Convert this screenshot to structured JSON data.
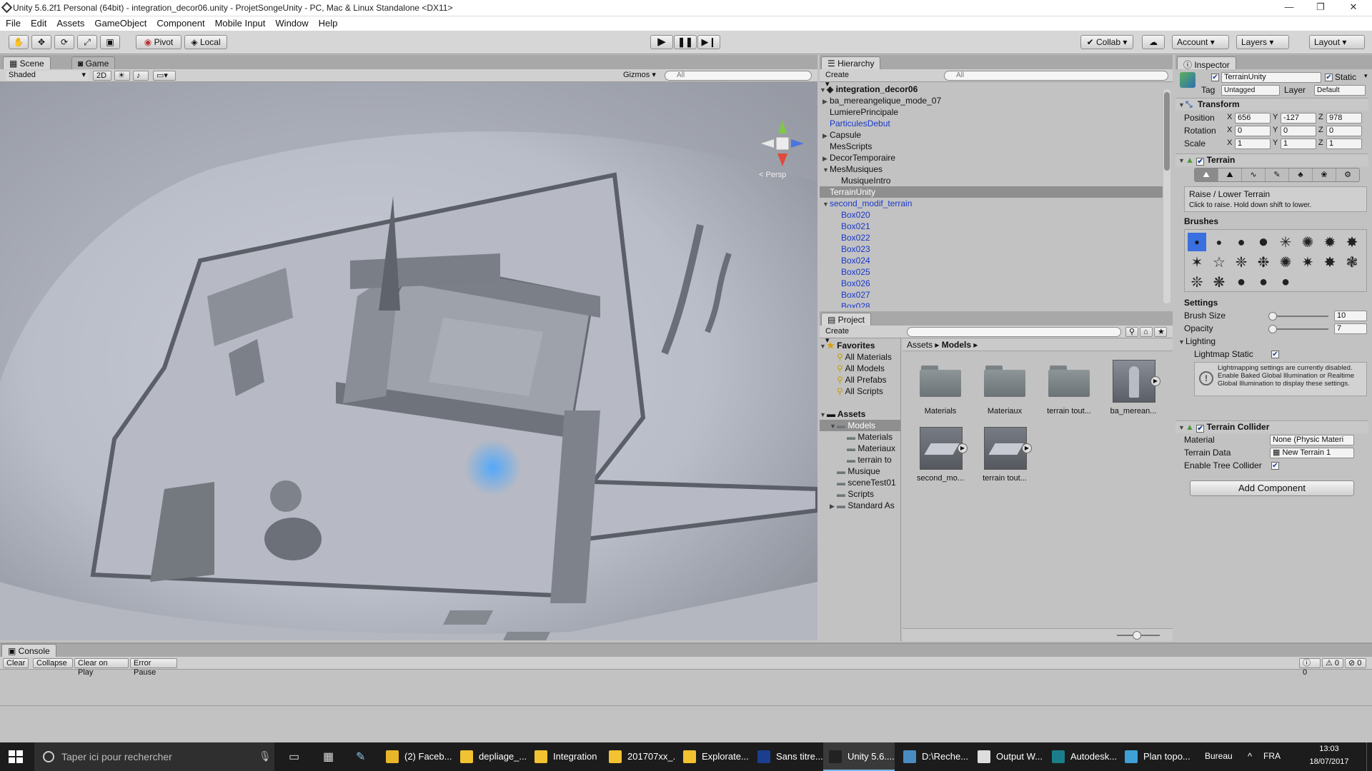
{
  "window": {
    "title": "Unity 5.6.2f1 Personal (64bit) - integration_decor06.unity - ProjetSongeUnity - PC, Mac & Linux Standalone <DX11>",
    "minimize": "—",
    "maximize": "❐",
    "close": "✕"
  },
  "menu": [
    "File",
    "Edit",
    "Assets",
    "GameObject",
    "Component",
    "Mobile Input",
    "Window",
    "Help"
  ],
  "toolbar": {
    "pivot": "Pivot",
    "local": "Local",
    "collab": "Collab",
    "account": "Account",
    "layers": "Layers",
    "layout": "Layout",
    "play_icon": "play-icon",
    "pause_icon": "pause-icon",
    "step_icon": "step-icon"
  },
  "scene": {
    "tab_scene": "Scene",
    "tab_game": "Game",
    "shading": "Shaded",
    "mode_2d": "2D",
    "gizmos": "Gizmos",
    "search_placeholder": "All",
    "persp": "< Persp"
  },
  "hierarchy": {
    "tab": "Hierarchy",
    "create": "Create",
    "search_placeholder": "All",
    "scene_name": "integration_decor06",
    "items": [
      {
        "label": "ba_mereangelique_mode_07",
        "arrow": "▶",
        "indent": 1,
        "blue": false,
        "selected": false
      },
      {
        "label": "LumierePrincipale",
        "arrow": "",
        "indent": 1,
        "blue": false,
        "selected": false
      },
      {
        "label": "ParticulesDebut",
        "arrow": "",
        "indent": 1,
        "blue": true,
        "selected": false
      },
      {
        "label": "Capsule",
        "arrow": "▶",
        "indent": 1,
        "blue": false,
        "selected": false
      },
      {
        "label": "MesScripts",
        "arrow": "",
        "indent": 1,
        "blue": false,
        "selected": false
      },
      {
        "label": "DecorTemporaire",
        "arrow": "▶",
        "indent": 1,
        "blue": false,
        "selected": false
      },
      {
        "label": "MesMusiques",
        "arrow": "▼",
        "indent": 1,
        "blue": false,
        "selected": false
      },
      {
        "label": "MusiqueIntro",
        "arrow": "",
        "indent": 2,
        "blue": false,
        "selected": false
      },
      {
        "label": "TerrainUnity",
        "arrow": "",
        "indent": 1,
        "blue": false,
        "selected": true
      },
      {
        "label": "second_modif_terrain",
        "arrow": "▼",
        "indent": 1,
        "blue": true,
        "selected": false
      },
      {
        "label": "Box020",
        "arrow": "",
        "indent": 2,
        "blue": true,
        "selected": false
      },
      {
        "label": "Box021",
        "arrow": "",
        "indent": 2,
        "blue": true,
        "selected": false
      },
      {
        "label": "Box022",
        "arrow": "",
        "indent": 2,
        "blue": true,
        "selected": false
      },
      {
        "label": "Box023",
        "arrow": "",
        "indent": 2,
        "blue": true,
        "selected": false
      },
      {
        "label": "Box024",
        "arrow": "",
        "indent": 2,
        "blue": true,
        "selected": false
      },
      {
        "label": "Box025",
        "arrow": "",
        "indent": 2,
        "blue": true,
        "selected": false
      },
      {
        "label": "Box026",
        "arrow": "",
        "indent": 2,
        "blue": true,
        "selected": false
      },
      {
        "label": "Box027",
        "arrow": "",
        "indent": 2,
        "blue": true,
        "selected": false
      },
      {
        "label": "Box028",
        "arrow": "",
        "indent": 2,
        "blue": true,
        "selected": false
      }
    ]
  },
  "project": {
    "tab": "Project",
    "create": "Create",
    "breadcrumb_root": "Assets",
    "breadcrumb_current": "Models",
    "favorites_label": "Favorites",
    "favorites": [
      "All Materials",
      "All Models",
      "All Prefabs",
      "All Scripts"
    ],
    "assets_label": "Assets",
    "tree": [
      {
        "label": "Models",
        "indent": 1,
        "arrow": "▼",
        "selected": true
      },
      {
        "label": "Materials",
        "indent": 2,
        "arrow": "",
        "selected": false
      },
      {
        "label": "Materiaux",
        "indent": 2,
        "arrow": "",
        "selected": false
      },
      {
        "label": "terrain to",
        "indent": 2,
        "arrow": "",
        "selected": false
      },
      {
        "label": "Musique",
        "indent": 1,
        "arrow": "",
        "selected": false
      },
      {
        "label": "sceneTest01",
        "indent": 1,
        "arrow": "",
        "selected": false
      },
      {
        "label": "Scripts",
        "indent": 1,
        "arrow": "",
        "selected": false
      },
      {
        "label": "Standard As",
        "indent": 1,
        "arrow": "▶",
        "selected": false
      }
    ],
    "grid": [
      {
        "label": "Materials",
        "kind": "folder"
      },
      {
        "label": "Materiaux",
        "kind": "folder"
      },
      {
        "label": "terrain tout...",
        "kind": "folder"
      },
      {
        "label": "ba_merean...",
        "kind": "model"
      },
      {
        "label": "second_mo...",
        "kind": "mesh"
      },
      {
        "label": "terrain tout...",
        "kind": "mesh"
      }
    ]
  },
  "inspector": {
    "tab": "Inspector",
    "object_name": "TerrainUnity",
    "static_label": "Static",
    "tag_label": "Tag",
    "tag_value": "Untagged",
    "layer_label": "Layer",
    "layer_value": "Default",
    "transform": {
      "title": "Transform",
      "position_label": "Position",
      "rotation_label": "Rotation",
      "scale_label": "Scale",
      "position": [
        "656",
        "-127",
        "978"
      ],
      "rotation": [
        "0",
        "0",
        "0"
      ],
      "scale": [
        "1",
        "1",
        "1"
      ]
    },
    "terrain": {
      "title": "Terrain",
      "tool_title": "Raise / Lower Terrain",
      "tool_hint": "Click to raise. Hold down shift to lower.",
      "brushes_label": "Brushes",
      "settings_label": "Settings",
      "brush_size_label": "Brush Size",
      "brush_size": "10",
      "brush_size_level": 0.05,
      "opacity_label": "Opacity",
      "opacity": "7",
      "opacity_level": 0.05,
      "lighting_label": "Lighting",
      "lightmap_static_label": "Lightmap Static",
      "lightmap_info": "Lightmapping settings are currently disabled. Enable Baked Global Illumination or Realtime Global Illumination to display these settings."
    },
    "collider": {
      "title": "Terrain Collider",
      "material_label": "Material",
      "material_value": "None (Physic Materi",
      "data_label": "Terrain Data",
      "data_value": "New Terrain 1",
      "tree_label": "Enable Tree Collider"
    },
    "add_component": "Add Component"
  },
  "console": {
    "tab": "Console",
    "buttons": [
      "Clear",
      "Collapse",
      "Clear on Play",
      "Error Pause"
    ],
    "counts": [
      "0",
      "0",
      "0"
    ]
  },
  "taskbar": {
    "search_placeholder": "Taper ici pour rechercher",
    "items": [
      "(2) Faceb...",
      "depliage_...",
      "Integration",
      "201707xx_...",
      "Explorate...",
      "Sans titre...",
      "Unity 5.6....",
      "D:\\Reche...",
      "Output W...",
      "Autodesk...",
      "Plan topo..."
    ],
    "bureau": "Bureau",
    "lang": "FRA",
    "time": "13:03",
    "date": "18/07/2017"
  }
}
